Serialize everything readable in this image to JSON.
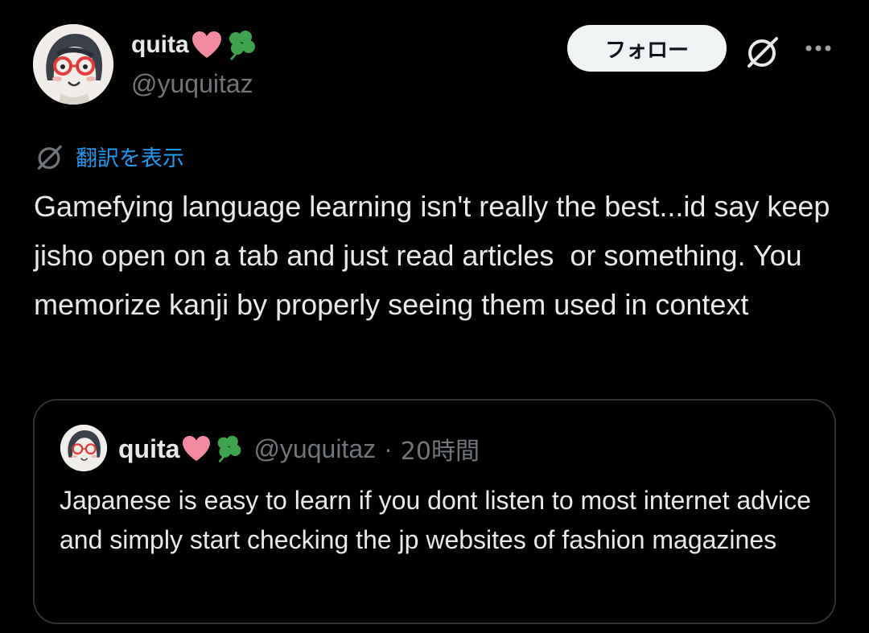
{
  "author": {
    "display_name": "quita",
    "emojis": [
      "pink-heart-icon",
      "four-leaf-clover-icon"
    ],
    "handle": "@yuquitaz"
  },
  "actions": {
    "follow_label": "フォロー",
    "grok_icon": "grok-icon",
    "more_icon": "more-options-icon"
  },
  "translate": {
    "icon": "grok-icon",
    "label": "翻訳を表示"
  },
  "tweet": {
    "text": "Gamefying language learning isn't really the best...id say keep jisho open on a tab and just read articles  or something. You memorize kanji by properly seeing them used in context"
  },
  "quote": {
    "display_name": "quita",
    "handle": "@yuquitaz",
    "separator": "·",
    "time": "20時間",
    "text": "Japanese is easy to learn if you dont listen to most internet advice and simply start checking the jp websites of fashion magazines"
  },
  "colors": {
    "background": "#000000",
    "text": "#e7e9ea",
    "muted": "#71767b",
    "link": "#1d9bf0",
    "border": "#2f3336",
    "follow_bg": "#eff3f4"
  }
}
